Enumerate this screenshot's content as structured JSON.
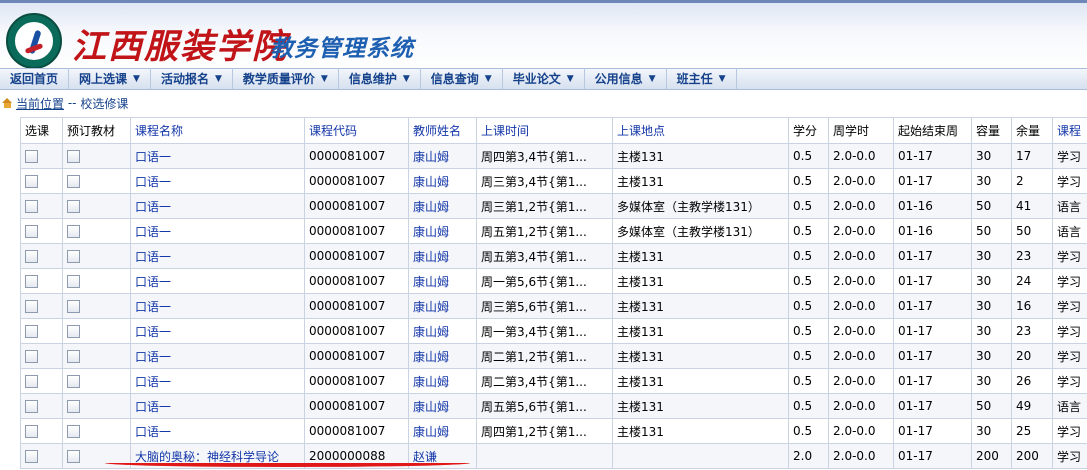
{
  "header": {
    "school_name": "江西服装学院",
    "system_name": "教务管理系统"
  },
  "nav": {
    "items": [
      {
        "label": "返回首页",
        "dropdown": false
      },
      {
        "label": "网上选课",
        "dropdown": true
      },
      {
        "label": "活动报名",
        "dropdown": true
      },
      {
        "label": "教学质量评价",
        "dropdown": true
      },
      {
        "label": "信息维护",
        "dropdown": true
      },
      {
        "label": "信息查询",
        "dropdown": true
      },
      {
        "label": "毕业论文",
        "dropdown": true
      },
      {
        "label": "公用信息",
        "dropdown": true
      },
      {
        "label": "班主任",
        "dropdown": true
      }
    ]
  },
  "breadcrumb": {
    "current": "当前位置",
    "separator": " -- ",
    "page": "校选修课"
  },
  "table": {
    "headers": [
      "选课",
      "预订教材",
      "课程名称",
      "课程代码",
      "教师姓名",
      "上课时间",
      "上课地点",
      "学分",
      "周学时",
      "起始结束周",
      "容量",
      "余量",
      "课程"
    ],
    "rows": [
      {
        "name": "口语一",
        "code": "0000081007",
        "teacher": "康山姆",
        "time": "周四第3,4节{第1...",
        "place": "主楼131",
        "credit": "0.5",
        "hours": "2.0-0.0",
        "weeks": "01-17",
        "capacity": "30",
        "remain": "17",
        "type": "学习"
      },
      {
        "name": "口语一",
        "code": "0000081007",
        "teacher": "康山姆",
        "time": "周三第3,4节{第1...",
        "place": "主楼131",
        "credit": "0.5",
        "hours": "2.0-0.0",
        "weeks": "01-17",
        "capacity": "30",
        "remain": "2",
        "type": "学习"
      },
      {
        "name": "口语一",
        "code": "0000081007",
        "teacher": "康山姆",
        "time": "周三第1,2节{第1...",
        "place": "多媒体室（主教学楼131）",
        "credit": "0.5",
        "hours": "2.0-0.0",
        "weeks": "01-16",
        "capacity": "50",
        "remain": "41",
        "type": "语言"
      },
      {
        "name": "口语一",
        "code": "0000081007",
        "teacher": "康山姆",
        "time": "周五第1,2节{第1...",
        "place": "多媒体室（主教学楼131）",
        "credit": "0.5",
        "hours": "2.0-0.0",
        "weeks": "01-16",
        "capacity": "50",
        "remain": "50",
        "type": "语言"
      },
      {
        "name": "口语一",
        "code": "0000081007",
        "teacher": "康山姆",
        "time": "周五第3,4节{第1...",
        "place": "主楼131",
        "credit": "0.5",
        "hours": "2.0-0.0",
        "weeks": "01-17",
        "capacity": "30",
        "remain": "23",
        "type": "学习"
      },
      {
        "name": "口语一",
        "code": "0000081007",
        "teacher": "康山姆",
        "time": "周一第5,6节{第1...",
        "place": "主楼131",
        "credit": "0.5",
        "hours": "2.0-0.0",
        "weeks": "01-17",
        "capacity": "30",
        "remain": "24",
        "type": "学习"
      },
      {
        "name": "口语一",
        "code": "0000081007",
        "teacher": "康山姆",
        "time": "周三第5,6节{第1...",
        "place": "主楼131",
        "credit": "0.5",
        "hours": "2.0-0.0",
        "weeks": "01-17",
        "capacity": "30",
        "remain": "16",
        "type": "学习"
      },
      {
        "name": "口语一",
        "code": "0000081007",
        "teacher": "康山姆",
        "time": "周一第3,4节{第1...",
        "place": "主楼131",
        "credit": "0.5",
        "hours": "2.0-0.0",
        "weeks": "01-17",
        "capacity": "30",
        "remain": "23",
        "type": "学习"
      },
      {
        "name": "口语一",
        "code": "0000081007",
        "teacher": "康山姆",
        "time": "周二第1,2节{第1...",
        "place": "主楼131",
        "credit": "0.5",
        "hours": "2.0-0.0",
        "weeks": "01-17",
        "capacity": "30",
        "remain": "20",
        "type": "学习"
      },
      {
        "name": "口语一",
        "code": "0000081007",
        "teacher": "康山姆",
        "time": "周二第3,4节{第1...",
        "place": "主楼131",
        "credit": "0.5",
        "hours": "2.0-0.0",
        "weeks": "01-17",
        "capacity": "30",
        "remain": "26",
        "type": "学习"
      },
      {
        "name": "口语一",
        "code": "0000081007",
        "teacher": "康山姆",
        "time": "周五第5,6节{第1...",
        "place": "主楼131",
        "credit": "0.5",
        "hours": "2.0-0.0",
        "weeks": "01-17",
        "capacity": "50",
        "remain": "49",
        "type": "语言"
      },
      {
        "name": "口语一",
        "code": "0000081007",
        "teacher": "康山姆",
        "time": "周四第1,2节{第1...",
        "place": "主楼131",
        "credit": "0.5",
        "hours": "2.0-0.0",
        "weeks": "01-17",
        "capacity": "30",
        "remain": "25",
        "type": "学习"
      },
      {
        "name": "大脑的奥秘：神经科学导论",
        "code": "2000000088",
        "teacher": "赵谦",
        "time": "",
        "place": "",
        "credit": "2.0",
        "hours": "2.0-0.0",
        "weeks": "01-17",
        "capacity": "200",
        "remain": "200",
        "type": "学习"
      }
    ]
  },
  "colors": {
    "link": "#1336a8",
    "nav_text": "#15428b",
    "school_red": "#c01418",
    "annotation_red": "#e01818"
  }
}
